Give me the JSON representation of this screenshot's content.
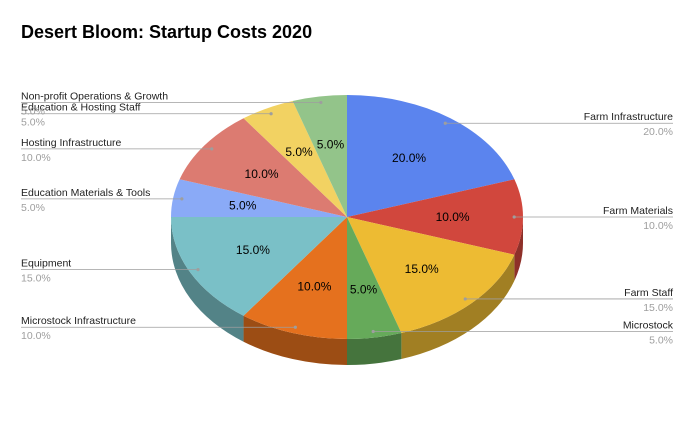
{
  "chart_data": {
    "type": "pie",
    "style": "3d",
    "title": "Desert Bloom: Startup Costs 2020",
    "slices": [
      {
        "label": "Farm Infrastructure",
        "value": 20.0,
        "display": "20.0%",
        "pct_text": "20.0%",
        "color": "#5b84ee"
      },
      {
        "label": "Farm Materials",
        "value": 10.0,
        "display": "10.0%",
        "pct_text": "10.0%",
        "color": "#d1473d"
      },
      {
        "label": "Farm Staff",
        "value": 15.0,
        "display": "15.0%",
        "pct_text": "15.0%",
        "color": "#edbb33"
      },
      {
        "label": "Microstock",
        "value": 5.0,
        "display": "5.0%",
        "pct_text": "5.0%",
        "color": "#66aa5a"
      },
      {
        "label": "Microstock Infrastructure",
        "value": 10.0,
        "display": "10.0%",
        "pct_text": "10.0%",
        "color": "#e5711e"
      },
      {
        "label": "Equipment",
        "value": 15.0,
        "display": "15.0%",
        "pct_text": "15.0%",
        "color": "#7ac0c7"
      },
      {
        "label": "Education Materials & Tools",
        "value": 5.0,
        "display": "5.0%",
        "pct_text": "5.0%",
        "color": "#8aaaf7"
      },
      {
        "label": "Hosting Infrastructure",
        "value": 10.0,
        "display": "10.0%",
        "pct_text": "10.0%",
        "color": "#dc7b71"
      },
      {
        "label": "Education & Hosting Staff",
        "value": 5.0,
        "display": "5.0%",
        "pct_text": "5.0%",
        "color": "#f2d262"
      },
      {
        "label": "Non-profit Operations & Growth",
        "value": 5.0,
        "display": "5.0%",
        "pct_text": "5.0%",
        "color": "#93c48a"
      }
    ]
  }
}
